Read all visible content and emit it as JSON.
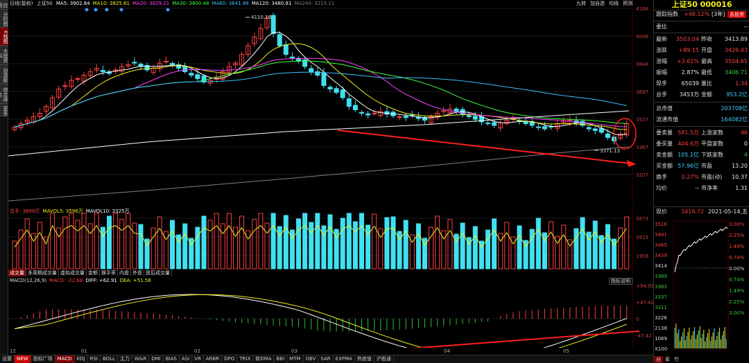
{
  "left_rail": [
    {
      "label": "应用",
      "active": false
    },
    {
      "label": "分时图",
      "active": false
    },
    {
      "label": "K线图",
      "active": true
    },
    {
      "label": "大盘资料",
      "active": false
    },
    {
      "label": "自选股",
      "active": false
    },
    {
      "label": "综合排名",
      "active": false
    },
    {
      "label": "更多",
      "active": false
    }
  ],
  "main_legend": {
    "period": "日线(复权)",
    "index": "上证50",
    "items": [
      {
        "text": "MA5: 3902.84",
        "color": "#ffffff"
      },
      {
        "text": "MA10: 3825.61",
        "color": "#f0f020"
      },
      {
        "text": "MA20: 3829.21",
        "color": "#ff40ff"
      },
      {
        "text": "MA30: 3800.48",
        "color": "#40ff40"
      },
      {
        "text": "MA60: 3641.88",
        "color": "#40c0ff"
      },
      {
        "text": "MA120: 3480.81",
        "color": "#ffffff"
      },
      {
        "text": "MA240: 3215.11",
        "color": "#808080"
      }
    ]
  },
  "top_tools": [
    "九转",
    "加自选",
    "均线",
    "预测"
  ],
  "price_axis": [
    "4166",
    "4006",
    "3846",
    "3687",
    "3527",
    "3367",
    "3207"
  ],
  "annotations": {
    "high": "4110.18",
    "low": "3371.13"
  },
  "volume_legend": {
    "items": [
      {
        "text": "总手: 3899万",
        "color": "#ff4040"
      },
      {
        "text": "MAVOL5: 3596万",
        "color": "#f0f020"
      },
      {
        "text": "MAVOL10: 3325万",
        "color": "#ffffff"
      }
    ],
    "axis": [
      "5873",
      "3915",
      "1958"
    ]
  },
  "volume_tabs": [
    {
      "label": "成交量",
      "active": true
    },
    {
      "label": "多周期成交量",
      "active": false
    },
    {
      "label": "虚拟成交量",
      "active": false
    },
    {
      "label": "金额",
      "active": false
    },
    {
      "label": "换手率",
      "active": false
    },
    {
      "label": "内盘",
      "active": false
    },
    {
      "label": "外盘",
      "active": false
    },
    {
      "label": "盘后成交量",
      "active": false
    }
  ],
  "macd_legend": {
    "items": [
      {
        "text": "MACD(12,26,9)",
        "color": "#dddddd"
      },
      {
        "text": "MACD: -22.68",
        "color": "#ff4040"
      },
      {
        "text": "DIFF: +62.91",
        "color": "#ffffff"
      },
      {
        "text": "DEA: +51.58",
        "color": "#f0f020"
      }
    ],
    "help": "指标说明",
    "axis": [
      "+94.92",
      "+47.42",
      "0",
      "-47.42"
    ]
  },
  "months": [
    "12",
    "01",
    "02",
    "03",
    "04",
    "05"
  ],
  "bottom_tabs": [
    {
      "label": "设置",
      "kind": "normal"
    },
    {
      "label": "NEW",
      "kind": "new"
    },
    {
      "label": "指标广场",
      "kind": "normal"
    },
    {
      "label": "MACD",
      "kind": "active"
    },
    {
      "label": "KDJ",
      "kind": "normal"
    },
    {
      "label": "RSI",
      "kind": "normal"
    },
    {
      "label": "BOLL",
      "kind": "normal"
    },
    {
      "label": "主力",
      "kind": "normal"
    },
    {
      "label": "W&R",
      "kind": "normal"
    },
    {
      "label": "DMI",
      "kind": "normal"
    },
    {
      "label": "BIAS",
      "kind": "normal"
    },
    {
      "label": "ASI",
      "kind": "normal"
    },
    {
      "label": "VR",
      "kind": "normal"
    },
    {
      "label": "ARBR",
      "kind": "normal"
    },
    {
      "label": "DPO",
      "kind": "normal"
    },
    {
      "label": "TRIX",
      "kind": "normal"
    },
    {
      "label": "新DMA",
      "kind": "normal"
    },
    {
      "label": "BBI",
      "kind": "normal"
    },
    {
      "label": "MTM",
      "kind": "normal"
    },
    {
      "label": "OBV",
      "kind": "normal"
    },
    {
      "label": "SAR",
      "kind": "normal"
    },
    {
      "label": "EXPMA",
      "kind": "normal"
    },
    {
      "label": "热度值",
      "kind": "normal"
    },
    {
      "label": "沪股通",
      "kind": "normal"
    }
  ],
  "quote": {
    "title": "上证50 000016",
    "track_label": "跟踪指数",
    "track_value": "+48.12%",
    "track_period": "[3年]",
    "track_btn": "去投资",
    "webi_label": "委比",
    "webi_value": "--",
    "rows": [
      {
        "k1": "最新",
        "v1": "3503.04",
        "c1": "red",
        "k2": "昨收",
        "v2": "3413.89",
        "c2": "white"
      },
      {
        "k1": "涨跌",
        "v1": "+89.15",
        "c1": "red",
        "k2": "开盘",
        "v2": "3426.43",
        "c2": "red"
      },
      {
        "k1": "涨幅",
        "v1": "+2.61%",
        "c1": "red",
        "k2": "最高",
        "v2": "3504.65",
        "c2": "red"
      },
      {
        "k1": "振幅",
        "v1": "2.87%",
        "c1": "white",
        "k2": "最低",
        "v2": "3406.71",
        "c2": "green"
      },
      {
        "k1": "现手",
        "v1": "65039",
        "c1": "white",
        "k2": "量比",
        "v2": "1.34",
        "c2": "red"
      },
      {
        "k1": "总手",
        "v1": "3453万",
        "c1": "white",
        "k2": "金额",
        "v2": "953.2亿",
        "c2": "cyan"
      }
    ],
    "rows2": [
      {
        "k": "总市值",
        "v": "203708亿",
        "c": "cyan"
      },
      {
        "k": "流通市值",
        "v": "164082亿",
        "c": "cyan"
      }
    ],
    "rows3": [
      {
        "k1": "委卖量",
        "v1": "581.5万",
        "c1": "red",
        "k2": "上涨家数",
        "v2": "46",
        "c2": "red"
      },
      {
        "k1": "委买量",
        "v1": "404.6万",
        "c1": "red",
        "k2": "平盘家数",
        "v2": "0",
        "c2": "white"
      },
      {
        "k1": "卖金额",
        "v1": "105.1亿",
        "c1": "cyan",
        "k2": "下跌家数",
        "v2": "4",
        "c2": "green"
      },
      {
        "k1": "买金额",
        "v1": "57.96亿",
        "c1": "cyan",
        "k2": "市盈",
        "v2": "13.20",
        "c2": "white"
      },
      {
        "k1": "换手",
        "v1": "0.27%",
        "c1": "red",
        "k2": "市盈(动)",
        "v2": "10.37",
        "c2": "white"
      },
      {
        "k1": "均价",
        "v1": "--",
        "c1": "white",
        "k2": "市净率",
        "v2": "1.31",
        "c2": "white"
      }
    ],
    "mini_header": {
      "label": "现价",
      "price": "3416.72",
      "date": "2021-05-14,五"
    },
    "mini_left_axis": [
      "3516",
      "3491",
      "3465",
      "3439",
      "3414",
      "3389",
      "3363",
      "3337",
      "3311",
      "3226",
      "2138",
      "1089",
      "X100"
    ],
    "mini_right_axis": [
      "3.00%",
      "2.25%",
      "1.49%",
      "0.74%",
      "0.00%",
      "0.74%",
      "1.49%",
      "2.25%",
      "3.00%"
    ],
    "mini_tabs": [
      {
        "label": "分",
        "active": true
      },
      {
        "label": "筹",
        "active": false
      },
      {
        "label": "竹",
        "active": false
      }
    ]
  },
  "colors": {
    "up": "#ff4040",
    "down": "#40e0f0",
    "arrow": "#ff2020",
    "circle": "#ff2020"
  }
}
